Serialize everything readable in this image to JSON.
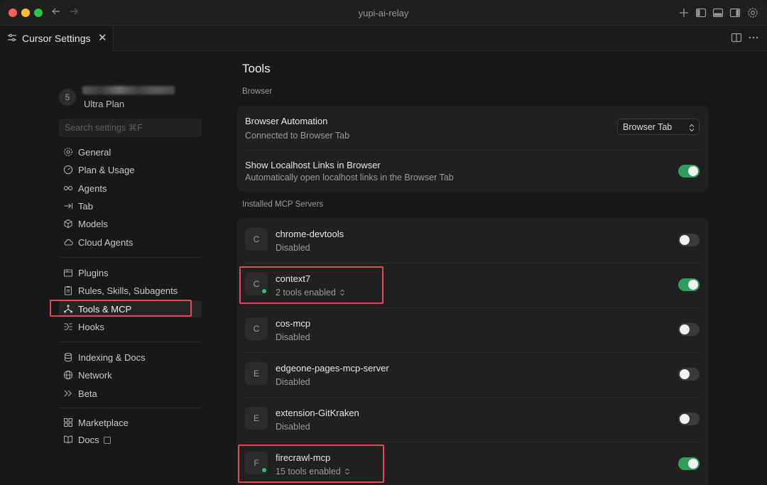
{
  "window": {
    "title": "yupi-ai-relay"
  },
  "tab": {
    "label": "Cursor Settings",
    "close": "✕"
  },
  "user": {
    "avatar_letter": "5",
    "plan": "Ultra Plan"
  },
  "search": {
    "placeholder": "Search settings ⌘F"
  },
  "sidebar": {
    "groups": [
      [
        {
          "label": "General",
          "icon": "gear-icon"
        },
        {
          "label": "Plan & Usage",
          "icon": "gauge-icon"
        },
        {
          "label": "Agents",
          "icon": "infinity-icon"
        },
        {
          "label": "Tab",
          "icon": "tab-arrow-icon"
        },
        {
          "label": "Models",
          "icon": "cube-icon"
        },
        {
          "label": "Cloud Agents",
          "icon": "cloud-icon"
        }
      ],
      [
        {
          "label": "Plugins",
          "icon": "package-icon"
        },
        {
          "label": "Rules, Skills, Subagents",
          "icon": "clipboard-icon"
        },
        {
          "label": "Tools & MCP",
          "icon": "network-nodes-icon",
          "active": true
        },
        {
          "label": "Hooks",
          "icon": "hooks-icon"
        }
      ],
      [
        {
          "label": "Indexing & Docs",
          "icon": "database-icon"
        },
        {
          "label": "Network",
          "icon": "globe-icon"
        },
        {
          "label": "Beta",
          "icon": "double-chevron-icon"
        }
      ],
      [
        {
          "label": "Marketplace",
          "icon": "grid-icon"
        },
        {
          "label": "Docs",
          "icon": "book-icon",
          "external": true
        }
      ]
    ]
  },
  "main": {
    "title": "Tools",
    "browser_section": "Browser",
    "browser_rows": {
      "automation_title": "Browser Automation",
      "automation_sub": "Connected to Browser Tab",
      "automation_select": "Browser Tab",
      "localhost_title": "Show Localhost Links in Browser",
      "localhost_sub": "Automatically open localhost links in the Browser Tab",
      "localhost_enabled": true
    },
    "mcp_section": "Installed MCP Servers",
    "servers": [
      {
        "letter": "C",
        "name": "chrome-devtools",
        "status": "Disabled",
        "enabled": false,
        "dot": false
      },
      {
        "letter": "C",
        "name": "context7",
        "status": "2 tools enabled",
        "enabled": true,
        "dot": true
      },
      {
        "letter": "C",
        "name": "cos-mcp",
        "status": "Disabled",
        "enabled": false,
        "dot": false
      },
      {
        "letter": "E",
        "name": "edgeone-pages-mcp-server",
        "status": "Disabled",
        "enabled": false,
        "dot": false
      },
      {
        "letter": "E",
        "name": "extension-GitKraken",
        "status": "Disabled",
        "enabled": false,
        "dot": false
      },
      {
        "letter": "F",
        "name": "firecrawl-mcp",
        "status": "15 tools enabled",
        "enabled": true,
        "dot": true
      }
    ]
  },
  "colors": {
    "accent_green": "#2f9e5b",
    "highlight_red": "#e5484d",
    "status_dot": "#34c26a"
  }
}
